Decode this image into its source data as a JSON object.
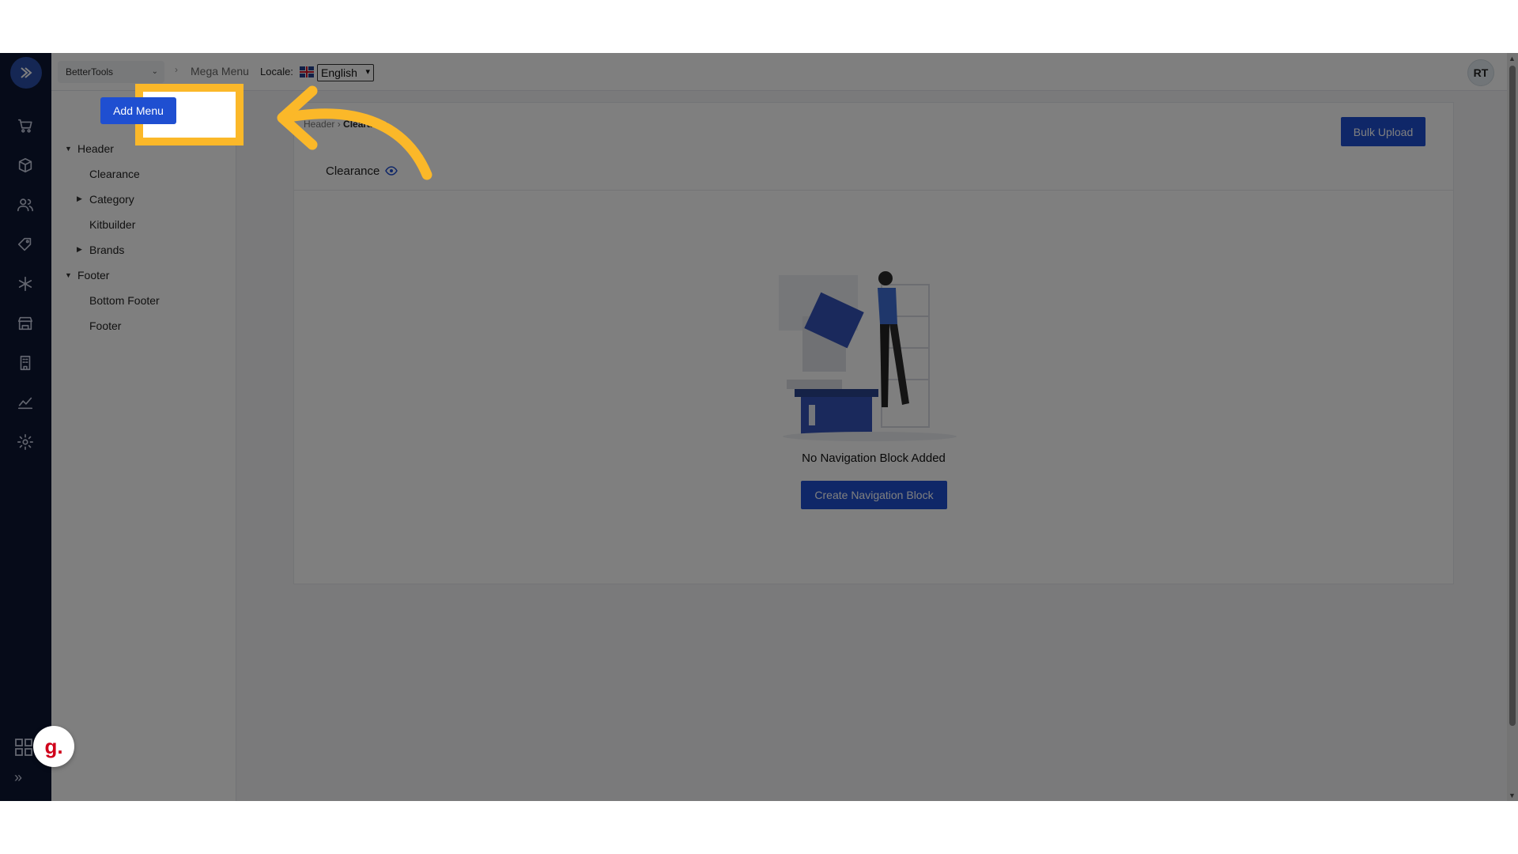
{
  "topbar": {
    "store_name": "BetterTools",
    "breadcrumb_page": "Mega Menu",
    "locale_label": "Locale:",
    "language": "English",
    "avatar_initials": "RT"
  },
  "tree": {
    "add_menu_label": "Add Menu",
    "items": [
      {
        "label": "Header",
        "level": 0,
        "expanded": true
      },
      {
        "label": "Clearance",
        "level": 1
      },
      {
        "label": "Category",
        "level": 1,
        "expanded": false
      },
      {
        "label": "Kitbuilder",
        "level": 1
      },
      {
        "label": "Brands",
        "level": 1,
        "expanded": false
      },
      {
        "label": "Footer",
        "level": 0,
        "expanded": true
      },
      {
        "label": "Bottom Footer",
        "level": 1
      },
      {
        "label": "Footer",
        "level": 1
      }
    ]
  },
  "main": {
    "breadcrumb_parent": "Header",
    "breadcrumb_current": "Clearance",
    "bulk_upload_label": "Bulk Upload",
    "title": "Clearance",
    "empty_message": "No Navigation Block Added",
    "create_block_label": "Create Navigation Block"
  },
  "badge": {
    "letter": "g."
  },
  "colors": {
    "primary": "#1f4fd1",
    "rail_bg": "#0d1633",
    "highlight": "#fbb829"
  }
}
